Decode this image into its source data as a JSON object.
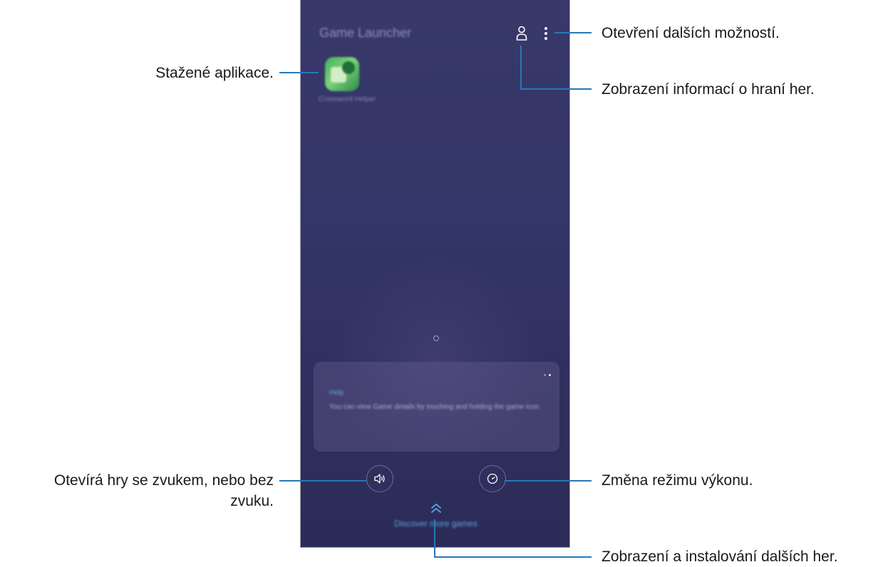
{
  "screen": {
    "app_title": "Game Launcher",
    "app_name": "Crossword Helper",
    "card": {
      "label": "Help",
      "text": "You can view Game details by touching and holding the game icon."
    },
    "discover_label": "Discover more games",
    "icons": {
      "profile": "person-icon",
      "more": "more-options-icon",
      "sound": "speaker-icon",
      "performance": "gauge-icon",
      "discover": "double-chevron-up-icon"
    },
    "colors": {
      "background": "#34356a",
      "accent": "#5aa3d6",
      "callout_line": "#2479b8"
    }
  },
  "annotations": {
    "downloaded_apps": "Stažené aplikace.",
    "more_options": "Otevření dalších možností.",
    "game_info": "Zobrazení informací o hraní her.",
    "sound_line1": "Otevírá hry se zvukem, nebo bez",
    "sound_line2": "zvuku.",
    "performance": "Změna režimu výkonu.",
    "discover": "Zobrazení a instalování dalších her."
  }
}
